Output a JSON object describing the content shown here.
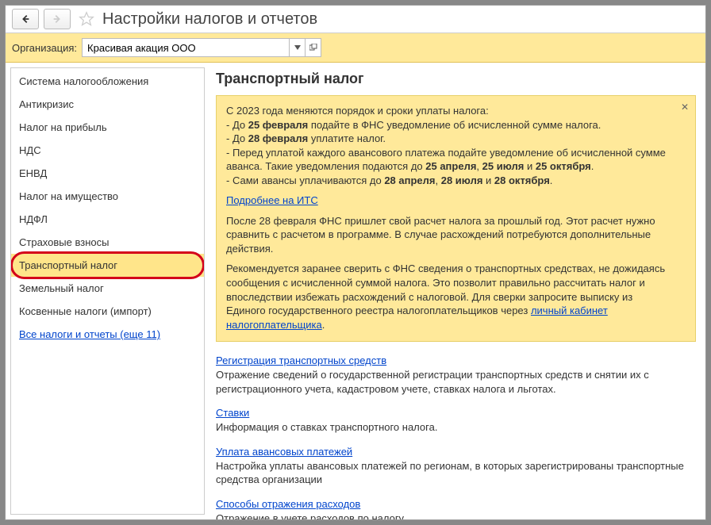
{
  "header": {
    "title": "Настройки налогов и отчетов"
  },
  "org": {
    "label": "Организация:",
    "value": "Красивая акация ООО"
  },
  "sidebar": {
    "items": [
      "Система налогообложения",
      "Антикризис",
      "Налог на прибыль",
      "НДС",
      "ЕНВД",
      "Налог на имущество",
      "НДФЛ",
      "Страховые взносы",
      "Транспортный налог",
      "Земельный налог",
      "Косвенные налоги (импорт)"
    ],
    "all_link": "Все налоги и отчеты (еще 11)"
  },
  "main": {
    "heading": "Транспортный налог",
    "notice": {
      "line1": "С 2023 года меняются порядок и сроки уплаты налога:",
      "bullet1_pre": " - До ",
      "bullet1_bold": "25 февраля",
      "bullet1_post": " подайте в ФНС уведомление об исчисленной сумме налога.",
      "bullet2_pre": " - До ",
      "bullet2_bold": "28 февраля",
      "bullet2_post": " уплатите налог.",
      "bullet3": " - Перед уплатой каждого авансового платежа подайте уведомление об исчисленной сумме аванса. Такие уведомления подаются до ",
      "b3_d1": "25 апреля",
      "b3_sep1": ", ",
      "b3_d2": "25 июля",
      "b3_sep2": " и ",
      "b3_d3": "25 октября",
      "b3_end": ".",
      "bullet4_pre": " - Сами авансы уплачиваются до ",
      "b4_d1": "28 апреля",
      "b4_sep1": ", ",
      "b4_d2": "28 июля",
      "b4_sep2": " и ",
      "b4_d3": "28 октября",
      "b4_end": ".",
      "more_link": "Подробнее на ИТС",
      "para2": "После 28 февраля ФНС пришлет свой расчет налога за прошлый год. Этот расчет нужно сравнить с расчетом в программе. В случае расхождений потребуются дополнительные действия.",
      "para3_a": "Рекомендуется заранее сверить с ФНС сведения о транспортных средствах, не дожидаясь сообщения с исчисленной суммой налога. Это позволит правильно рассчитать налог и впоследствии избежать расхождений с налоговой. Для сверки запросите выписку из Единого государственного реестра налогоплательщиков через ",
      "para3_link": "личный кабинет налогоплательщика",
      "para3_b": "."
    },
    "sections": [
      {
        "link": "Регистрация транспортных средств",
        "desc": "Отражение сведений о государственной регистрации транспортных средств и снятии их с регистрационного учета, кадастровом учете, ставках налога и льготах."
      },
      {
        "link": "Ставки",
        "desc": "Информация о ставках транспортного налога."
      },
      {
        "link": "Уплата авансовых платежей",
        "desc": "Настройка уплаты авансовых платежей по регионам, в которых зарегистрированы транспортные средства организации"
      },
      {
        "link": "Способы отражения расходов",
        "desc": "Отражение в учете расходов по налогу."
      }
    ]
  }
}
